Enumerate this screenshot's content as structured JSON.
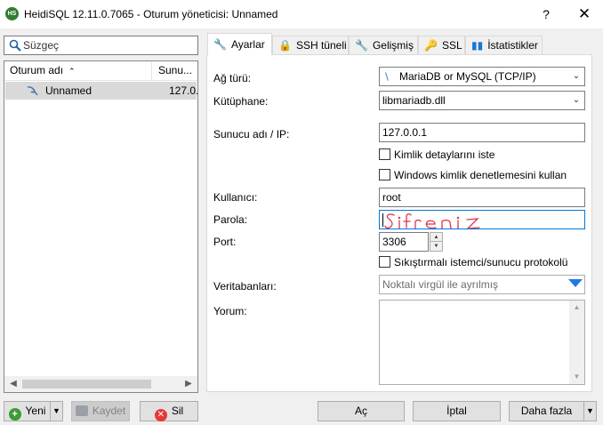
{
  "window": {
    "title": "HeidiSQL 12.11.0.7065 - Oturum yöneticisi: Unnamed",
    "app_icon_text": "HS",
    "help_label": "?",
    "close_label": "✕"
  },
  "sidebar": {
    "filter_placeholder": "Süzgeç",
    "columns": [
      "Oturum adı",
      "Sunucu"
    ],
    "columns_visible": [
      "Oturum adı",
      "Sunu..."
    ],
    "sessions": [
      {
        "name": "Unnamed",
        "host_visible": "127.0...",
        "selected": true
      }
    ]
  },
  "tabs": [
    {
      "label": "Ayarlar",
      "icon": "wrench-icon",
      "active": true
    },
    {
      "label": "SSH tüneli",
      "icon": "lock-icon",
      "active": false
    },
    {
      "label": "Gelişmiş",
      "icon": "wrench-icon",
      "active": false
    },
    {
      "label": "SSL",
      "icon": "key-icon",
      "active": false
    },
    {
      "label": "İstatistikler",
      "icon": "bar-chart-icon",
      "active": false
    }
  ],
  "form": {
    "network_type_label": "Ağ türü:",
    "network_type_value": "MariaDB or MySQL (TCP/IP)",
    "library_label": "Kütüphane:",
    "library_value": "libmariadb.dll",
    "host_label": "Sunucu adı / IP:",
    "host_value": "127.0.0.1",
    "prompt_credentials_label": "Kimlik detaylarını iste",
    "prompt_credentials_checked": false,
    "windows_auth_label": "Windows kimlik denetlemesini kullan",
    "windows_auth_checked": false,
    "user_label": "Kullanıcı:",
    "user_value": "root",
    "password_label": "Parola:",
    "password_handwritten": "Şifreniz",
    "port_label": "Port:",
    "port_value": "3306",
    "compression_label": "Sıkıştırmalı istemci/sunucu protokolü",
    "compression_checked": false,
    "databases_label": "Veritabanları:",
    "databases_placeholder": "Noktalı virgül ile ayrılmış",
    "comment_label": "Yorum:"
  },
  "buttons": {
    "new": "Yeni",
    "save": "Kaydet",
    "delete": "Sil",
    "open": "Aç",
    "cancel": "İptal",
    "more": "Daha fazla"
  },
  "colors": {
    "selection": "#d9d9d9",
    "focus_border": "#0078d7",
    "handwriting": "#e0304a",
    "dropdown_arrow": "#1e7be6"
  }
}
